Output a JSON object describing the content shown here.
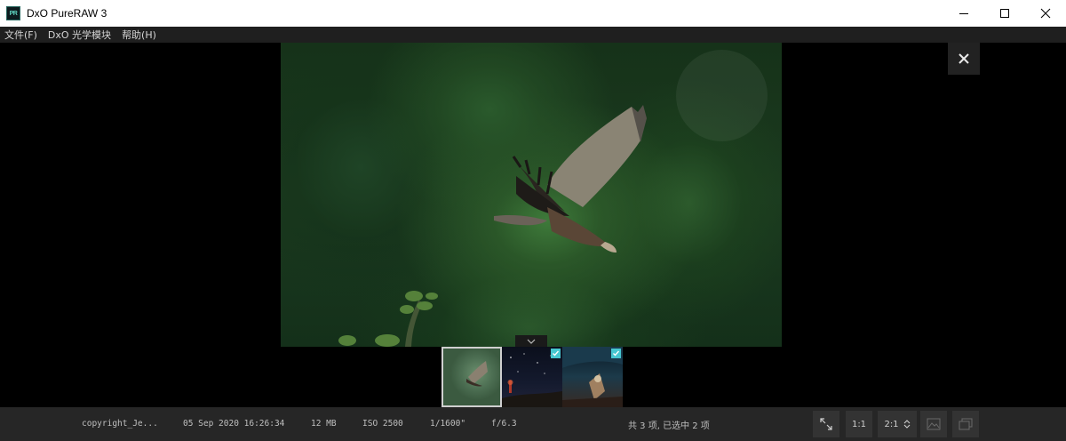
{
  "window": {
    "title": "DxO PureRAW 3",
    "logo_text": "PR"
  },
  "menu": {
    "items": [
      "文件(F)",
      "DxO 光学模块",
      "帮助(H)"
    ]
  },
  "thumbnails": [
    {
      "selected": true,
      "checked": false
    },
    {
      "selected": false,
      "checked": true
    },
    {
      "selected": false,
      "checked": true
    }
  ],
  "status": {
    "copyright": "copyright_Je...",
    "date": "05 Sep 2020 16:26:34",
    "size": "12 MB",
    "iso": "ISO 2500",
    "shutter": "1/1600\"",
    "aperture": "f/6.3",
    "count": "共 3 项, 已选中 2 项",
    "zoom_1": "1:1",
    "zoom_2": "2:1"
  },
  "colors": {
    "accent_check": "#46c6d0",
    "status_bg": "#262626",
    "menu_bg": "#1f1f1f"
  },
  "icons": [
    "minimize-icon",
    "maximize-icon",
    "close-icon",
    "chevron-down-icon",
    "fullscreen-icon",
    "compare-icon",
    "stack-icon",
    "check-icon"
  ]
}
